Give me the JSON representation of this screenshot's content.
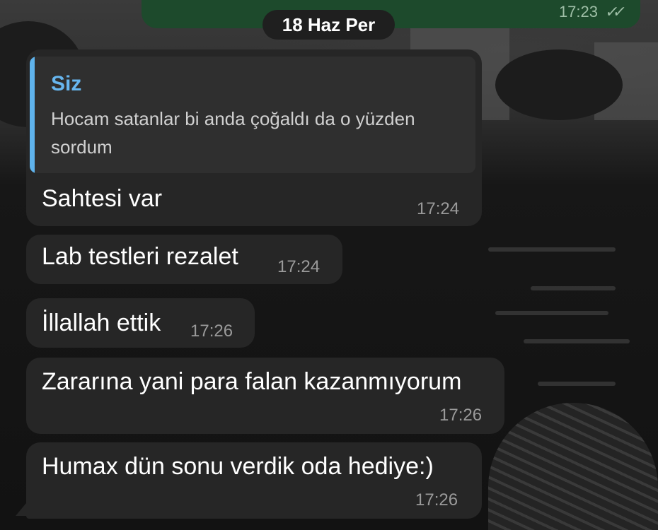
{
  "outgoing": {
    "time": "17:23",
    "ticks_icon": "double-check-icon"
  },
  "date_pill": "18 Haz Per",
  "first_message": {
    "reply": {
      "author": "Siz",
      "text": "Hocam satanlar bi anda çoğaldı da o yüzden sordum"
    },
    "text": "Sahtesi var",
    "time": "17:24"
  },
  "messages": [
    {
      "text": "Lab testleri rezalet",
      "time": "17:24"
    },
    {
      "text": "İllallah ettik",
      "time": "17:26"
    },
    {
      "text": "Zararına yani para falan kazanmıyorum",
      "time": "17:26"
    },
    {
      "text": "Humax dün sonu verdik oda hediye:)",
      "time": "17:26"
    }
  ],
  "colors": {
    "incoming_bubble": "#262626",
    "outgoing_bubble": "#1d4a2c",
    "reply_accent": "#5fb3ec"
  }
}
